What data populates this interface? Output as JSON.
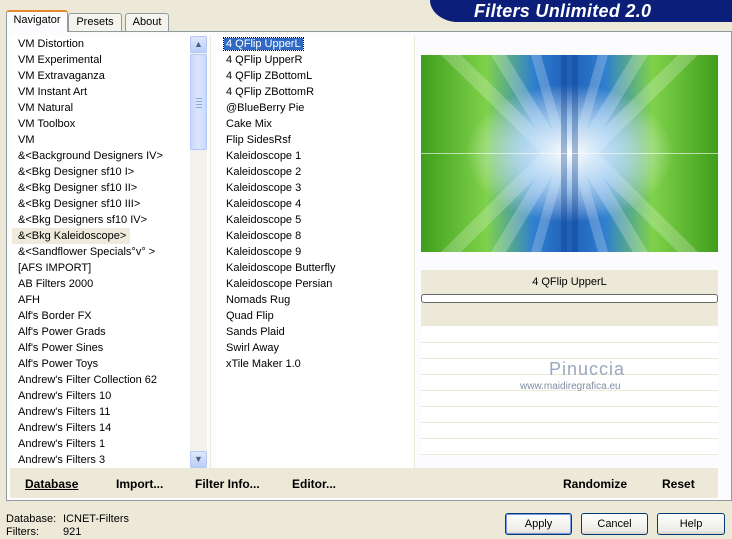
{
  "title": "Filters Unlimited 2.0",
  "tabs": [
    "Navigator",
    "Presets",
    "About"
  ],
  "categories": [
    "VM Distortion",
    "VM Experimental",
    "VM Extravaganza",
    "VM Instant Art",
    "VM Natural",
    "VM Toolbox",
    "VM",
    "&<Background Designers IV>",
    "&<Bkg Designer sf10 I>",
    "&<Bkg Designer sf10 II>",
    "&<Bkg Designer sf10 III>",
    "&<Bkg Designers sf10 IV>",
    "&<Bkg Kaleidoscope>",
    "&<Sandflower Specials°v° >",
    "[AFS IMPORT]",
    "AB Filters 2000",
    "AFH",
    "Alf's Border FX",
    "Alf's Power Grads",
    "Alf's Power Sines",
    "Alf's Power Toys",
    "Andrew's Filter Collection 62",
    "Andrew's Filters 10",
    "Andrew's Filters 11",
    "Andrew's Filters 14",
    "Andrew's Filters 1",
    "Andrew's Filters 3"
  ],
  "selected_category": "&<Bkg Kaleidoscope>",
  "filters": [
    "4 QFlip UpperL",
    "4 QFlip UpperR",
    "4 QFlip ZBottomL",
    "4 QFlip ZBottomR",
    "@BlueBerry Pie",
    "Cake Mix",
    "Flip SidesRsf",
    "Kaleidoscope 1",
    "Kaleidoscope 2",
    "Kaleidoscope 3",
    "Kaleidoscope 4",
    "Kaleidoscope 5",
    "Kaleidoscope 8",
    "Kaleidoscope 9",
    "Kaleidoscope Butterfly",
    "Kaleidoscope Persian",
    "Nomads Rug",
    "Quad Flip",
    "Sands Plaid",
    "Swirl Away",
    "xTile Maker 1.0"
  ],
  "selected_filter": "4 QFlip UpperL",
  "preview_label": "4 QFlip UpperL",
  "watermark": {
    "name": "Pinuccia",
    "url": "www.maidiregrafica.eu"
  },
  "bottom_links": {
    "database": "Database",
    "import": "Import...",
    "filter_info": "Filter Info...",
    "editor": "Editor...",
    "randomize": "Randomize",
    "reset": "Reset"
  },
  "status": {
    "database_label": "Database:",
    "database_value": "ICNET-Filters",
    "filters_label": "Filters:",
    "filters_value": "921"
  },
  "buttons": {
    "apply": "Apply",
    "cancel": "Cancel",
    "help": "Help"
  },
  "colors": {
    "banner": "#0b1f7a",
    "selection": "#316ac5",
    "tab_accent": "#e68b2c"
  }
}
